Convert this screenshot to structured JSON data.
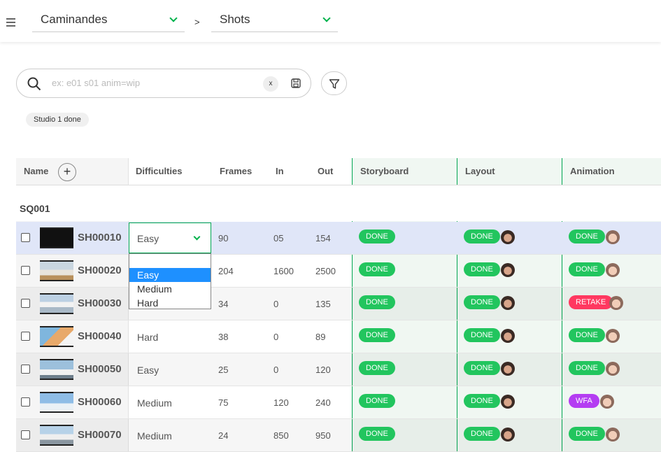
{
  "breadcrumb": {
    "production": "Caminandes",
    "section": "Shots",
    "separator": ">"
  },
  "search": {
    "placeholder": "ex: e01 s01 anim=wip",
    "clear_label": "x"
  },
  "filter_tag": "Studio 1 done",
  "columns": {
    "name": "Name",
    "add": "+",
    "difficulties": "Difficulties",
    "frames": "Frames",
    "in": "In",
    "out": "Out",
    "storyboard": "Storyboard",
    "layout": "Layout",
    "animation": "Animation"
  },
  "sequence": "SQ001",
  "dropdown": {
    "selected": "Easy",
    "options": [
      "",
      "Easy",
      "Medium",
      "Hard"
    ]
  },
  "colors": {
    "accent": "#00b24b",
    "done": "#22c55e",
    "retake": "#ff3860",
    "wfa": "#b43df2",
    "selected_row": "#e0e6f8",
    "dropdown_highlight": "#1e90ff"
  },
  "shots": [
    {
      "name": "SH00010",
      "difficulty": "Easy",
      "frames": "90",
      "in": "05",
      "out": "154",
      "storyboard": "DONE",
      "layout": "DONE",
      "animation": "DONE",
      "animation_color": "done"
    },
    {
      "name": "SH00020",
      "difficulty": "",
      "frames": "204",
      "in": "1600",
      "out": "2500",
      "storyboard": "DONE",
      "layout": "DONE",
      "animation": "DONE",
      "animation_color": "done"
    },
    {
      "name": "SH00030",
      "difficulty": "",
      "frames": "34",
      "in": "0",
      "out": "135",
      "storyboard": "DONE",
      "layout": "DONE",
      "animation": "RETAKE",
      "animation_color": "retake"
    },
    {
      "name": "SH00040",
      "difficulty": "Hard",
      "frames": "38",
      "in": "0",
      "out": "89",
      "storyboard": "DONE",
      "layout": "DONE",
      "animation": "DONE",
      "animation_color": "done"
    },
    {
      "name": "SH00050",
      "difficulty": "Easy",
      "frames": "25",
      "in": "0",
      "out": "120",
      "storyboard": "DONE",
      "layout": "DONE",
      "animation": "DONE",
      "animation_color": "done"
    },
    {
      "name": "SH00060",
      "difficulty": "Medium",
      "frames": "75",
      "in": "120",
      "out": "240",
      "storyboard": "DONE",
      "layout": "DONE",
      "animation": "WFA",
      "animation_color": "wfa"
    },
    {
      "name": "SH00070",
      "difficulty": "Medium",
      "frames": "24",
      "in": "850",
      "out": "950",
      "storyboard": "DONE",
      "layout": "DONE",
      "animation": "DONE",
      "animation_color": "done"
    }
  ]
}
